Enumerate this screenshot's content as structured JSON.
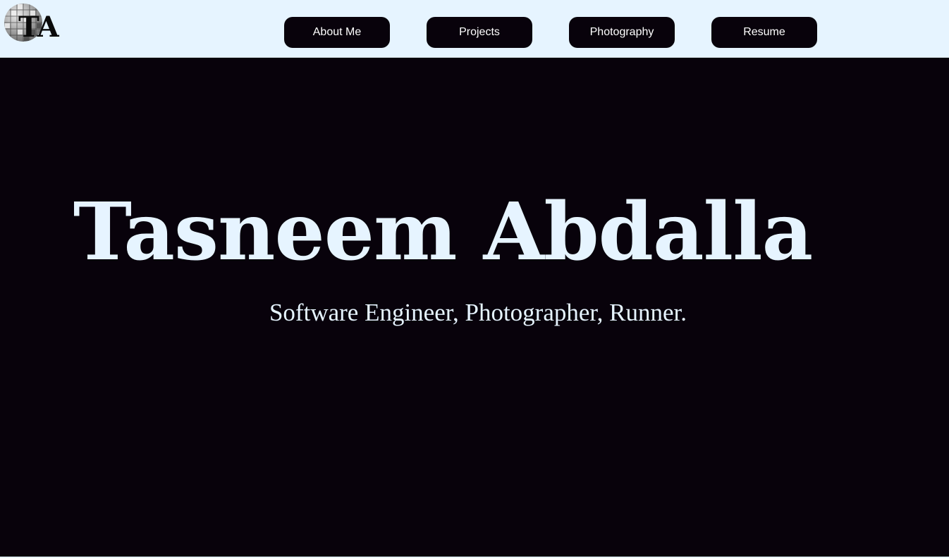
{
  "header": {
    "logo_text": "TA",
    "nav": [
      {
        "label": "About Me"
      },
      {
        "label": "Projects"
      },
      {
        "label": "Photography"
      },
      {
        "label": "Resume"
      }
    ]
  },
  "hero": {
    "name": "Tasneem Abdalla",
    "tagline": "Software Engineer, Photographer, Runner."
  },
  "colors": {
    "header_bg": "#e6f4ff",
    "page_bg": "#08020b",
    "text_light": "#e6f4ff"
  }
}
